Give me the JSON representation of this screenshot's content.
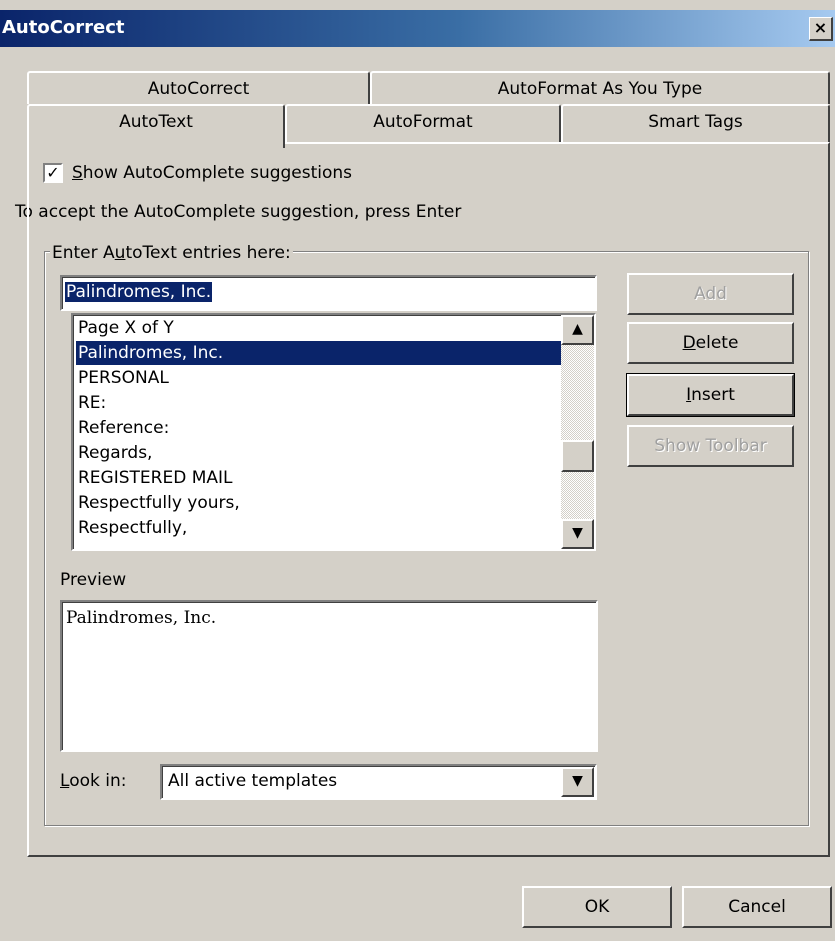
{
  "window": {
    "title": "AutoCorrect",
    "close_glyph": "×"
  },
  "tabs": {
    "back_row": [
      {
        "label": "AutoCorrect"
      },
      {
        "label": "AutoFormat As You Type"
      }
    ],
    "front_row": [
      {
        "label": "AutoText",
        "active": true
      },
      {
        "label": "AutoFormat"
      },
      {
        "label": "Smart Tags"
      }
    ]
  },
  "options": {
    "show_autocomplete": {
      "checked": true,
      "label_prefix": "S",
      "label_rest": "how AutoComplete suggestions"
    },
    "hint": "To accept the AutoComplete suggestion, press Enter"
  },
  "entries": {
    "group_label_prefix": "Enter A",
    "group_label_u": "u",
    "group_label_rest": "toText entries here:",
    "input_value": "Palindromes, Inc.",
    "list": [
      "Page X of Y",
      "Palindromes, Inc.",
      "PERSONAL",
      "RE:",
      "Reference:",
      "Regards,",
      "REGISTERED MAIL",
      "Respectfully yours,",
      "Respectfully,"
    ],
    "selected_index": 1
  },
  "side_buttons": {
    "add": "Add",
    "delete_u": "D",
    "delete_rest": "elete",
    "insert_u": "I",
    "insert_rest": "nsert",
    "show_toolbar": "Show Toolbar"
  },
  "preview": {
    "label": "Preview",
    "text": "Palindromes, Inc."
  },
  "look_in": {
    "label_u": "L",
    "label_rest": "ook in:",
    "value": "All active templates"
  },
  "footer": {
    "ok": "OK",
    "cancel": "Cancel"
  },
  "icons": {
    "scroll_up": "▲",
    "scroll_down": "▼",
    "dropdown": "▼",
    "check": "✓"
  }
}
